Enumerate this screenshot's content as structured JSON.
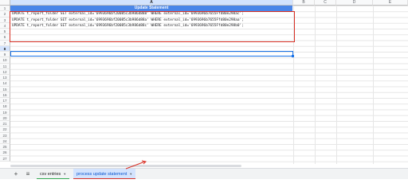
{
  "columns": [
    "A",
    "B",
    "C",
    "D",
    "E"
  ],
  "rows": [
    "1",
    "2",
    "3",
    "4",
    "5",
    "6",
    "7",
    "8",
    "9",
    "10",
    "11",
    "12",
    "13",
    "14",
    "15",
    "16",
    "17",
    "18",
    "19",
    "20",
    "21",
    "22",
    "23",
    "24",
    "25",
    "26",
    "27"
  ],
  "header": {
    "title": "Update Statement"
  },
  "statements": [
    "UPDATE t_report_folder SET external_id='6993696bf20085c3b986d888' WHERE external_id='6993696b7655Ffd80e298ac';",
    "UPDATE t_report_folder SET external_id='6993696bf20085c3b986d88a' WHERE external_id='6993696b7655Ffd80e298aa';",
    "UPDATE t_report_folder SET external_id='6993696bf20085c3b986d88c' WHERE external_id='6993696b7655Ffd80e298b0';"
  ],
  "tabs": {
    "add_label": "+",
    "list_label": "≡",
    "csv_entries": "csv entries",
    "process_update_statement": "process update statement"
  },
  "colors": {
    "header_bg": "#4a86e8",
    "highlight_red": "#d93025",
    "active_tab": "#d3e3fd",
    "csv_tab_underline": "#34a853"
  }
}
